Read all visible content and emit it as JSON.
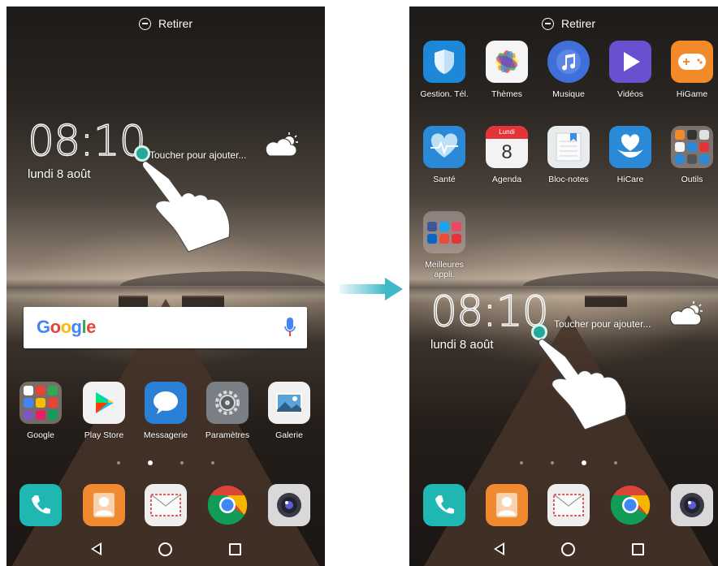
{
  "left_screen": {
    "top_bar": {
      "label": "Retirer"
    },
    "clock": {
      "time": "08:10",
      "date": "lundi 8 août"
    },
    "weather_hint": "Toucher pour ajouter...",
    "search": {
      "logo": "Google"
    },
    "apps": [
      {
        "label": "Google",
        "icon": "google-folder-icon"
      },
      {
        "label": "Play Store",
        "icon": "play-store-icon"
      },
      {
        "label": "Messagerie",
        "icon": "messaging-icon"
      },
      {
        "label": "Paramètres",
        "icon": "settings-icon"
      },
      {
        "label": "Galerie",
        "icon": "gallery-icon"
      }
    ],
    "page_dots": {
      "count": 4,
      "active_index": 1
    },
    "dock": [
      {
        "icon": "phone-icon"
      },
      {
        "icon": "contacts-icon"
      },
      {
        "icon": "email-icon"
      },
      {
        "icon": "chrome-icon"
      },
      {
        "icon": "camera-icon"
      }
    ]
  },
  "right_screen": {
    "top_bar": {
      "label": "Retirer"
    },
    "apps_row1": [
      {
        "label": "Gestion. Tél.",
        "icon": "shield-icon"
      },
      {
        "label": "Thèmes",
        "icon": "themes-icon"
      },
      {
        "label": "Musique",
        "icon": "music-icon"
      },
      {
        "label": "Vidéos",
        "icon": "video-icon"
      },
      {
        "label": "HiGame",
        "icon": "gamepad-icon"
      }
    ],
    "apps_row2": [
      {
        "label": "Santé",
        "icon": "health-icon"
      },
      {
        "label": "Agenda",
        "icon": "calendar-icon",
        "day_name": "Lundi",
        "day_number": "8"
      },
      {
        "label": "Bloc-notes",
        "icon": "notepad-icon"
      },
      {
        "label": "HiCare",
        "icon": "hicare-icon"
      },
      {
        "label": "Outils",
        "icon": "tools-folder-icon"
      }
    ],
    "apps_row3": [
      {
        "label": "Meilleures appli.",
        "icon": "top-apps-folder-icon"
      }
    ],
    "clock": {
      "time": "08:10",
      "date": "lundi 8 août"
    },
    "weather_hint": "Toucher pour ajouter...",
    "page_dots": {
      "count": 4,
      "active_index": 2
    },
    "dock": [
      {
        "icon": "phone-icon"
      },
      {
        "icon": "contacts-icon"
      },
      {
        "icon": "email-icon"
      },
      {
        "icon": "chrome-icon"
      },
      {
        "icon": "camera-icon"
      }
    ]
  },
  "colors": {
    "accent_teal": "#23a89a",
    "arrow": "#3fb8c8"
  }
}
